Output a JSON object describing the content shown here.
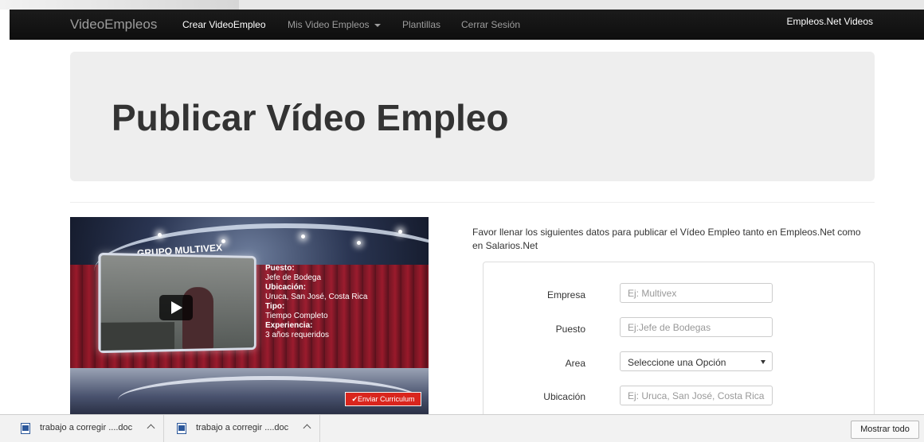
{
  "navbar": {
    "brand": "VideoEmpleos",
    "items": [
      {
        "label": "Crear VideoEmpleo",
        "active": true
      },
      {
        "label": "Mis Video Empleos",
        "dropdown": true
      },
      {
        "label": "Plantillas"
      },
      {
        "label": "Cerrar Sesión"
      }
    ],
    "right_label": "Empleos.Net Videos"
  },
  "jumbotron": {
    "title": "Publicar Vídeo Empleo"
  },
  "video": {
    "company": "GRUPO MULTIVEX",
    "info": [
      {
        "label": "Puesto:",
        "value": "Jefe de Bodega"
      },
      {
        "label": "Ubicación:",
        "value": "Uruca, San José, Costa Rica"
      },
      {
        "label": "Tipo:",
        "value": "Tiempo Completo"
      },
      {
        "label": "Experiencia:",
        "value": "3 años requeridos"
      }
    ],
    "cta": "✔Enviar Curriculum"
  },
  "form": {
    "intro": "Favor llenar los siguientes datos para publicar el Vídeo Empleo tanto en Empleos.Net como en Salarios.Net",
    "fields": [
      {
        "label": "Empresa",
        "placeholder": "Ej: Multivex"
      },
      {
        "label": "Puesto",
        "placeholder": "Ej:Jefe de Bodegas"
      },
      {
        "label": "Area",
        "selected": "Seleccione una Opción"
      },
      {
        "label": "Ubicación",
        "placeholder": "Ej: Uruca, San José, Costa Rica"
      }
    ]
  },
  "downloads": {
    "items": [
      {
        "name": "trabajo a corregir ....doc"
      },
      {
        "name": "trabajo a corregir ....doc"
      }
    ],
    "show_all": "Mostrar todo"
  }
}
